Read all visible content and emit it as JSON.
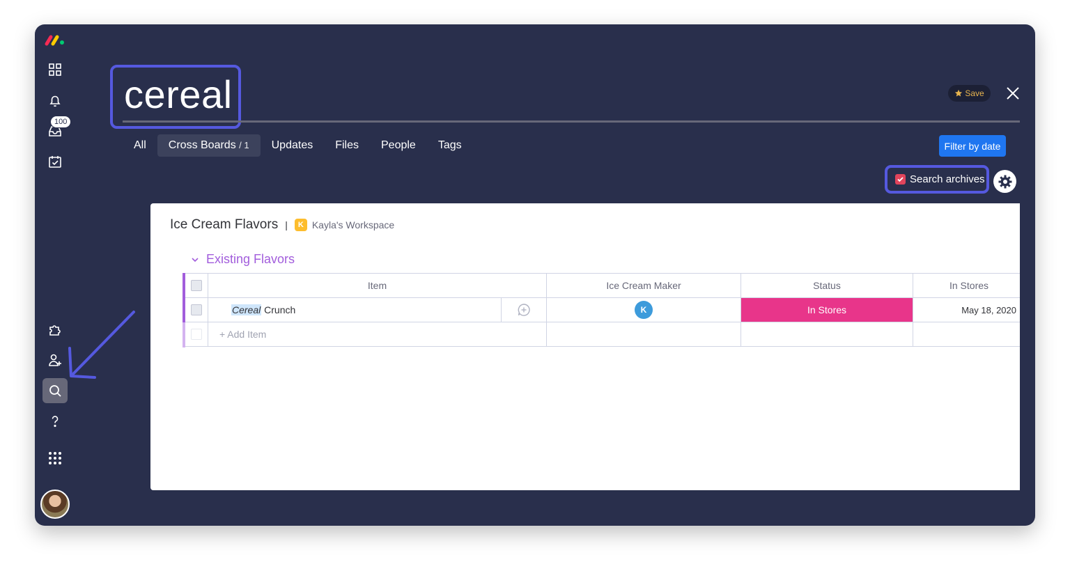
{
  "sidebar": {
    "inbox_badge": "100",
    "items": [
      {
        "name": "my-work-icon"
      },
      {
        "name": "bell-icon"
      },
      {
        "name": "inbox-icon"
      },
      {
        "name": "calendar-check-icon"
      },
      {
        "name": "puzzle-icon"
      },
      {
        "name": "invite-user-icon"
      },
      {
        "name": "search-icon"
      },
      {
        "name": "help-icon"
      },
      {
        "name": "apps-grid-icon"
      }
    ]
  },
  "search": {
    "query": "cereal"
  },
  "header": {
    "save_label": "Save"
  },
  "tabs": [
    {
      "label": "All"
    },
    {
      "label": "Cross Boards",
      "count": "/ 1"
    },
    {
      "label": "Updates"
    },
    {
      "label": "Files"
    },
    {
      "label": "People"
    },
    {
      "label": "Tags"
    }
  ],
  "filters": {
    "filter_by_date": "Filter by date",
    "search_archives": "Search archives",
    "search_archives_checked": true
  },
  "board": {
    "title": "Ice Cream Flavors",
    "separator": "|",
    "workspace_initial": "K",
    "workspace_name": "Kayla's Workspace",
    "group": {
      "title": "Existing Flavors",
      "color": "#a25ddc",
      "columns": [
        "Item",
        "Ice Cream Maker",
        "Status",
        "In Stores"
      ],
      "rows": [
        {
          "item_highlight": "Cereal",
          "item_rest": " Crunch",
          "maker_initial": "K",
          "status": "In Stores",
          "status_color": "#e8358a",
          "in_stores": "May 18, 2020"
        }
      ],
      "add_item": "+ Add Item"
    }
  },
  "colors": {
    "background": "#292f4c",
    "accent": "#5559df",
    "primary_button": "#1f76f0"
  }
}
